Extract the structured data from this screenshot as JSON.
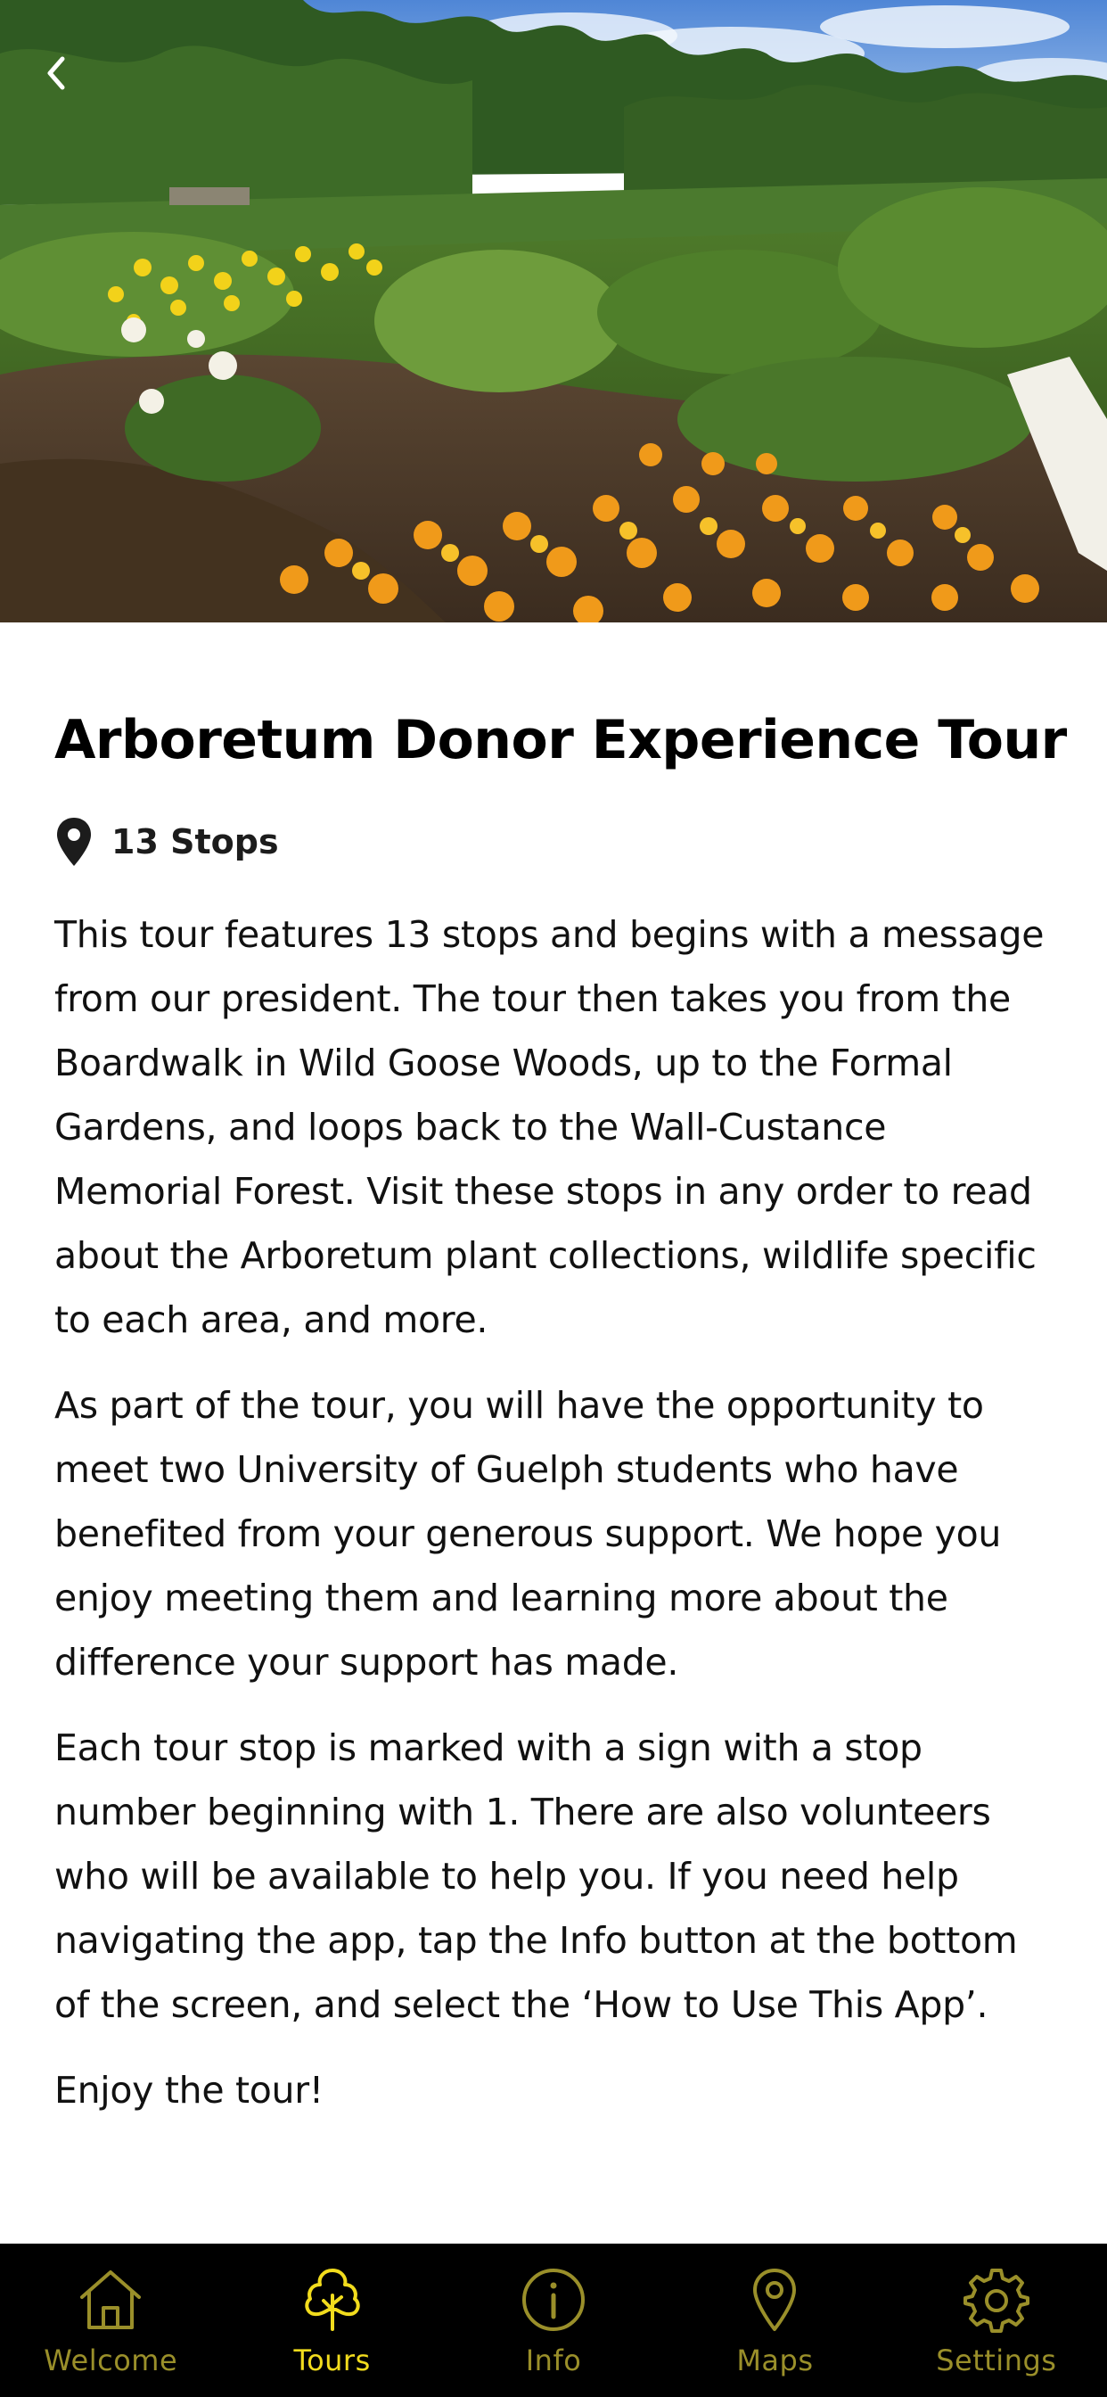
{
  "header": {
    "back_icon": "chevron-left-icon"
  },
  "hero": {
    "description_icon": "garden-photo"
  },
  "tour": {
    "title": "Arboretum Donor Experience Tour",
    "stops_icon": "map-pin-icon",
    "stops_label": "13 Stops",
    "paragraphs": [
      "This tour features 13 stops and begins with a message from our president. The tour then takes you from the Boardwalk in Wild Goose Woods, up to the Formal Gardens, and loops back to the Wall-Custance Memorial Forest. Visit these stops in any order to read about the Arboretum plant collections, wildlife specific to each area, and more.",
      "As part of the tour, you will have the opportunity to meet two University of Guelph students who have benefited from your generous support. We hope you enjoy meeting them and learning more about the difference your support has made.",
      "Each tour stop is marked with a sign with a stop number beginning with 1. There are also volunteers who will be available to help you. If you need help navigating the app, tap the Info button at the bottom of the screen, and select the ‘How to Use This App’.",
      "Enjoy the tour!"
    ]
  },
  "tabbar": {
    "active": "Tours",
    "accent_color": "#f2dc1d",
    "inactive_color": "#9a8f2a",
    "background": "#000000",
    "items": [
      {
        "label": "Welcome",
        "icon": "home-icon"
      },
      {
        "label": "Tours",
        "icon": "tree-icon"
      },
      {
        "label": "Info",
        "icon": "info-icon"
      },
      {
        "label": "Maps",
        "icon": "map-pin-icon"
      },
      {
        "label": "Settings",
        "icon": "gear-icon"
      }
    ]
  }
}
